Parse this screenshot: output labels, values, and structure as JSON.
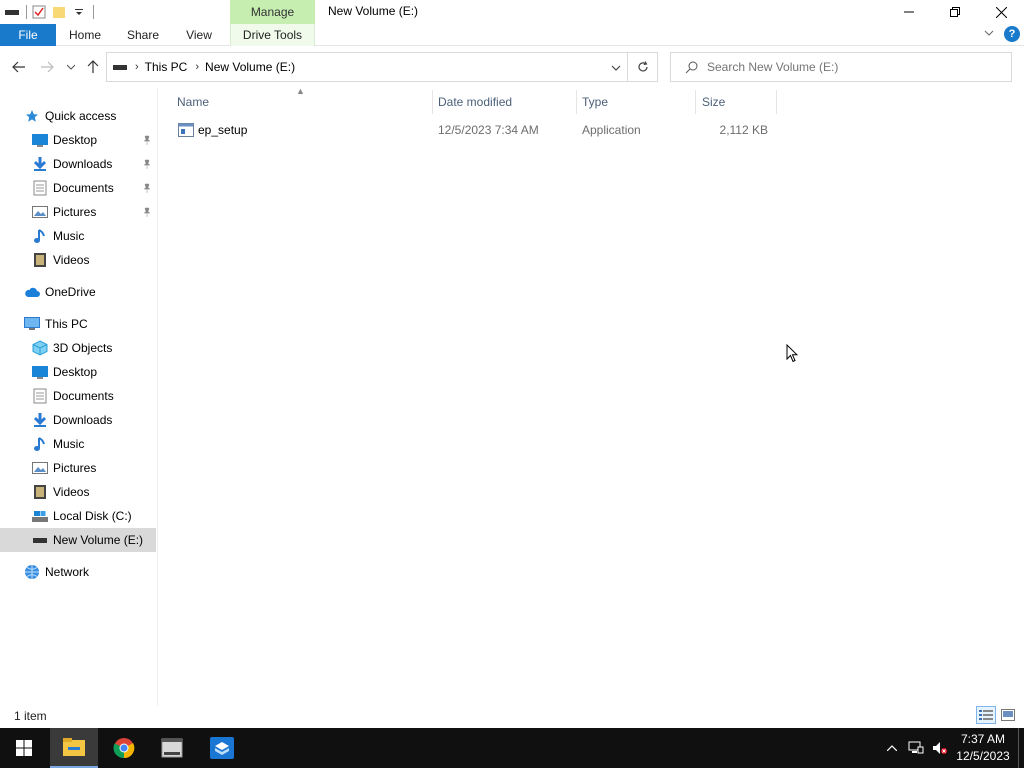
{
  "window": {
    "title": "New Volume (E:)",
    "contextual_tab": "Manage"
  },
  "ribbon": {
    "tabs": [
      "File",
      "Home",
      "Share",
      "View",
      "Drive Tools"
    ]
  },
  "address": {
    "crumbs": [
      "This PC",
      "New Volume (E:)"
    ]
  },
  "search": {
    "placeholder": "Search New Volume (E:)"
  },
  "nav": {
    "quick_access": "Quick access",
    "qa_items": [
      "Desktop",
      "Downloads",
      "Documents",
      "Pictures",
      "Music",
      "Videos"
    ],
    "onedrive": "OneDrive",
    "this_pc": "This PC",
    "pc_items": [
      "3D Objects",
      "Desktop",
      "Documents",
      "Downloads",
      "Music",
      "Pictures",
      "Videos",
      "Local Disk (C:)",
      "New Volume (E:)"
    ],
    "network": "Network"
  },
  "columns": {
    "name": "Name",
    "date": "Date modified",
    "type": "Type",
    "size": "Size"
  },
  "files": [
    {
      "name": "ep_setup",
      "date": "12/5/2023 7:34 AM",
      "type": "Application",
      "size": "2,112 KB"
    }
  ],
  "status": {
    "count": "1 item"
  },
  "clock": {
    "time": "7:37 AM",
    "date": "12/5/2023"
  },
  "colors": {
    "accent": "#1979ca",
    "manage_tab": "#c6eeb1",
    "selected_nav": "#d9d9d9",
    "taskbar": "#101010"
  }
}
